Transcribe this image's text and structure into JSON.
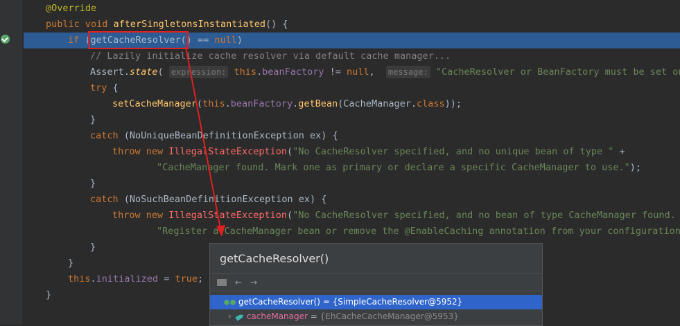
{
  "editor": {
    "lines": [
      {
        "parts": [
          [
            "ann",
            "@Override"
          ]
        ]
      },
      {
        "parts": [
          [
            "kw",
            "public "
          ],
          [
            "kw",
            "void "
          ],
          [
            "fn",
            "afterSingletonsInstantiated"
          ],
          [
            "",
            "() {"
          ]
        ]
      },
      {
        "parts": [
          [
            "kw",
            "if "
          ],
          [
            "",
            "("
          ],
          [
            "",
            "getCacheResolver()"
          ],
          [
            "",
            " == "
          ],
          [
            "kw",
            "null"
          ],
          [
            "",
            ")"
          ]
        ]
      },
      {
        "parts": [
          [
            "cmt",
            "// Lazily initialize cache resolver via default cache manager..."
          ]
        ]
      },
      {
        "parts": [
          [
            "",
            "Assert."
          ],
          [
            "fni",
            "state"
          ],
          [
            "",
            "( "
          ],
          [
            "hint",
            "expression:"
          ],
          [
            "",
            " "
          ],
          [
            "kw",
            "this"
          ],
          [
            "",
            "."
          ],
          [
            "fld",
            "beanFactory"
          ],
          [
            "",
            " != "
          ],
          [
            "kw",
            "null"
          ],
          [
            "",
            ",  "
          ],
          [
            "hint",
            "message:"
          ],
          [
            "str",
            " \"CacheResolver or BeanFactory must be set on cac"
          ]
        ]
      },
      {
        "parts": [
          [
            "kw",
            "try "
          ],
          [
            "",
            "{"
          ]
        ]
      },
      {
        "parts": [
          [
            "fn",
            "setCacheManager"
          ],
          [
            "",
            "("
          ],
          [
            "kw",
            "this"
          ],
          [
            "",
            "."
          ],
          [
            "fld",
            "beanFactory"
          ],
          [
            "",
            "."
          ],
          [
            "fn",
            "getBean"
          ],
          [
            "",
            "(CacheManager."
          ],
          [
            "kw",
            "class"
          ],
          [
            "",
            "));"
          ]
        ]
      },
      {
        "parts": [
          [
            "",
            "}"
          ]
        ]
      },
      {
        "parts": [
          [
            "kw",
            "catch "
          ],
          [
            "",
            "(NoUniqueBeanDefinitionException ex) {"
          ]
        ]
      },
      {
        "parts": [
          [
            "kw",
            "throw new "
          ],
          [
            "err",
            "IllegalStateException"
          ],
          [
            "",
            "("
          ],
          [
            "str",
            "\"No CacheResolver specified, and no unique bean of type \""
          ],
          [
            "",
            " +"
          ]
        ]
      },
      {
        "parts": [
          [
            "str",
            "\"CacheManager found. Mark one as primary or declare a specific CacheManager to use.\""
          ],
          [
            "",
            ");"
          ]
        ]
      },
      {
        "parts": [
          [
            "",
            "}"
          ]
        ]
      },
      {
        "parts": [
          [
            "kw",
            "catch "
          ],
          [
            "",
            "(NoSuchBeanDefinitionException ex) {"
          ]
        ]
      },
      {
        "parts": [
          [
            "kw",
            "throw new "
          ],
          [
            "err",
            "IllegalStateException"
          ],
          [
            "",
            "("
          ],
          [
            "str",
            "\"No CacheResolver specified, and no bean of type CacheManager found. \""
          ]
        ]
      },
      {
        "parts": [
          [
            "str",
            "\"Register a CacheManager bean or remove the @EnableCaching annotation from your configuration.\""
          ]
        ]
      },
      {
        "parts": [
          [
            "",
            "}"
          ]
        ]
      },
      {
        "parts": [
          [
            "",
            "}"
          ]
        ]
      },
      {
        "parts": [
          [
            "kw",
            "this"
          ],
          [
            "",
            "."
          ],
          [
            "fld",
            "initialized"
          ],
          [
            "",
            " = "
          ],
          [
            "kw",
            "true"
          ],
          [
            "",
            ";"
          ]
        ]
      },
      {
        "parts": [
          [
            "",
            "}"
          ]
        ]
      }
    ]
  },
  "popup": {
    "title": "getCacheResolver()",
    "rows": [
      {
        "name": "getCacheResolver()",
        "eq": " = ",
        "value": "{SimpleCacheResolver@5952}"
      },
      {
        "name": "cacheManager",
        "eq": " = ",
        "value": "{EhCacheCacheManager@5953}"
      }
    ],
    "toolbar": {
      "back": "←",
      "forward": "→"
    }
  },
  "colors": {
    "highlight": "#2d5b93",
    "annotation_box": "#e02020",
    "arrow": "#e02020",
    "selection": "#2f65ca"
  }
}
